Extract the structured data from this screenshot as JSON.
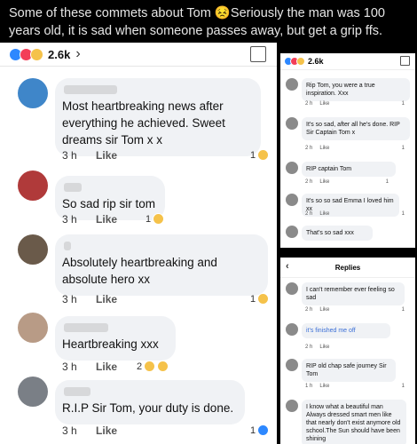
{
  "caption": "Some of these commets about Tom 😣Seriously the man was 100 years old, it is sad when someone passes away, but get a grip ffs.",
  "left": {
    "reaction_count": "2.6k",
    "comments": [
      {
        "text": "Most heartbreaking news after everything he achieved. Sweet dreams sir Tom x x",
        "time": "3 h",
        "like": "Like",
        "reactions": "1"
      },
      {
        "text": "So sad rip sir tom",
        "time": "3 h",
        "like": "Like",
        "reactions": "1"
      },
      {
        "text": "Absolutely heartbreaking and absolute hero xx",
        "time": "3 h",
        "like": "Like",
        "reactions": "1"
      },
      {
        "text": "Heartbreaking xxx",
        "time": "3 h",
        "like": "Like",
        "reactions": "2"
      },
      {
        "text": "R.I.P Sir Tom, your duty is done.",
        "time": "3 h",
        "like": "Like",
        "reactions": "1"
      }
    ]
  },
  "right_top": {
    "reaction_count": "2.6k",
    "comments": [
      {
        "text": "Rip Tom, you were a true inspiration. Xxx",
        "time": "2 h",
        "like": "Like",
        "reactions": "1"
      },
      {
        "text": "It's so sad, after all he's done. RIP Sir Captain Tom x",
        "time": "2 h",
        "like": "Like",
        "reactions": "1"
      },
      {
        "text": "RIP captain Tom",
        "time": "2 h",
        "like": "Like",
        "reactions": "1"
      },
      {
        "text": "It's so so sad Emma I loved him xx",
        "time": "2 h",
        "like": "Like",
        "reactions": "1"
      },
      {
        "text": "That's so sad xxx",
        "time": "",
        "like": "",
        "reactions": ""
      }
    ]
  },
  "right_bottom": {
    "header": "Replies",
    "comments": [
      {
        "text": "I can't remember ever feeling so sad",
        "time": "2 h",
        "like": "Like",
        "reactions": "1"
      },
      {
        "text": "it's finished me off",
        "time": "2 h",
        "like": "Like",
        "reactions": ""
      },
      {
        "text": "RIP old chap safe journey Sir Tom",
        "time": "1 h",
        "like": "Like",
        "reactions": "1"
      },
      {
        "text": "I know what a beautiful man Always dressed smart men like that nearly don't exist anymore old school.The Sun should have been shining",
        "time": "",
        "like": "",
        "reactions": ""
      }
    ]
  }
}
